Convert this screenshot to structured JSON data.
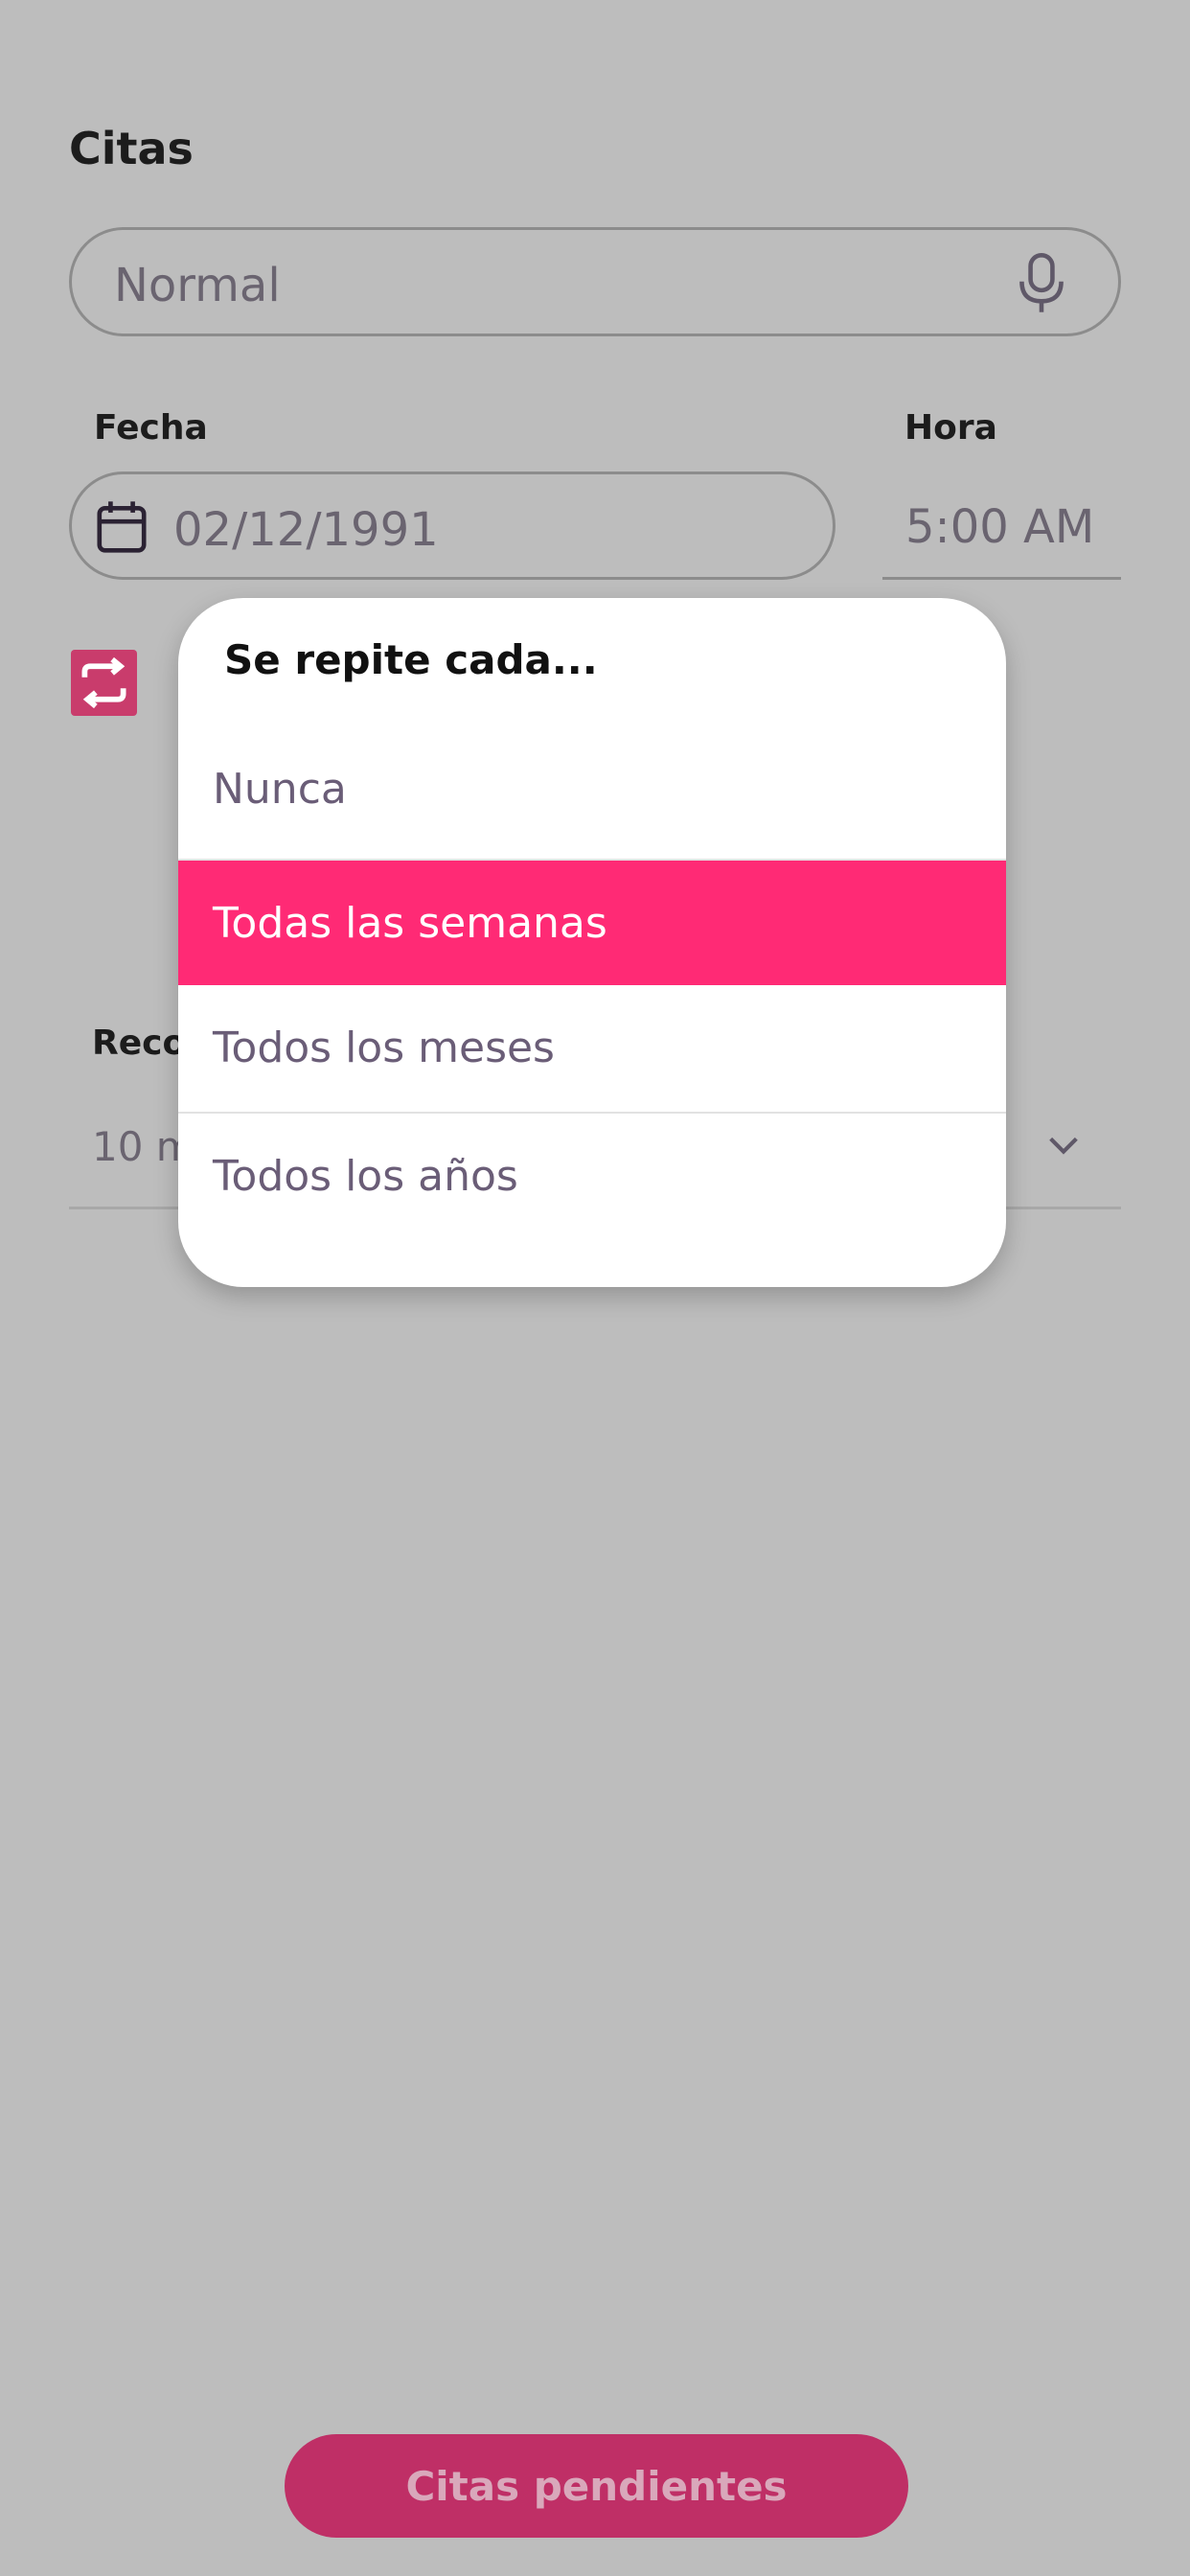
{
  "page": {
    "title": "Citas"
  },
  "title_field": {
    "value": "Normal",
    "icon": "mic-icon"
  },
  "date": {
    "label": "Fecha",
    "value": "02/12/1991",
    "icon": "calendar-icon"
  },
  "time": {
    "label": "Hora",
    "value": "5:00 AM"
  },
  "repeat": {
    "icon": "repeat-icon",
    "color": "#c93c6c"
  },
  "reminder": {
    "label": "Reco",
    "value": "10 m",
    "icon": "chevron-down-icon"
  },
  "footer": {
    "pending_label": "Citas pendientes",
    "color": "#bf2f66"
  },
  "repeat_dialog": {
    "title": "Se repite  cada...",
    "options": [
      {
        "label": "Nunca",
        "selected": false
      },
      {
        "label": "Todas las semanas",
        "selected": true
      },
      {
        "label": "Todos los meses",
        "selected": false
      },
      {
        "label": "Todos los años",
        "selected": false
      }
    ],
    "selected_color": "#ff2a75"
  },
  "colors": {
    "overlay_background": "#bdbdbd",
    "muted_text": "#6a6470"
  }
}
